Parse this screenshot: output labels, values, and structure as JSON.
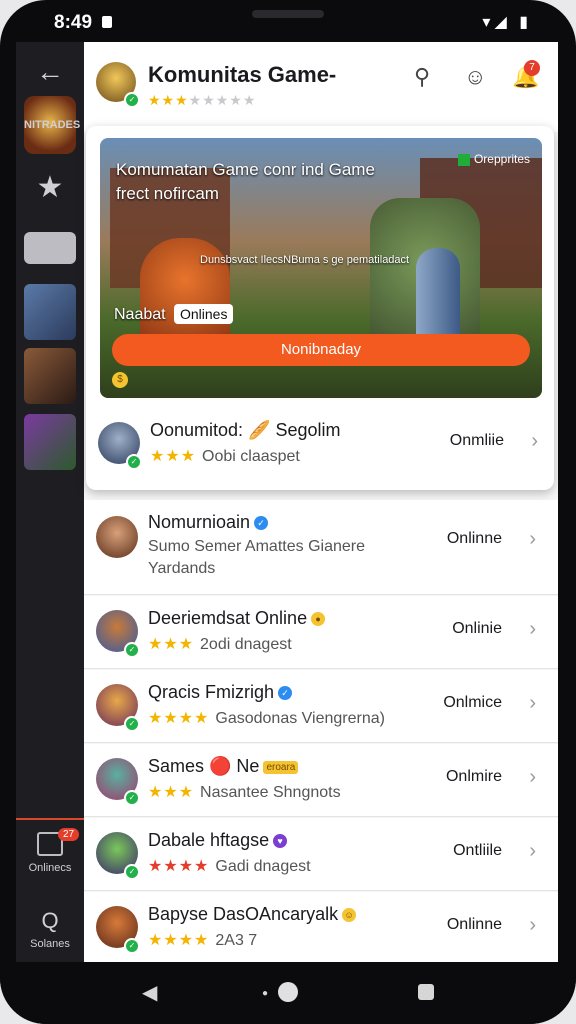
{
  "status": {
    "time": "8:49",
    "icons": "▾◢ ▮"
  },
  "rail": {
    "back": "←",
    "logo": "NITRADES",
    "star": "★",
    "onlines_label": "Onlinecs",
    "onlines_badge": "27",
    "search_label": "Solanes",
    "search_icon": "Q"
  },
  "header": {
    "title": "Komunitas Game-",
    "stars_on": "★★★",
    "stars_off": "★★★★★",
    "icons": [
      "search-icon",
      "profile-icon",
      "notification-icon"
    ],
    "notif_badge": "7"
  },
  "banner": {
    "title_line1": "Komumatan Game conr ind Game",
    "title_line2": "frect nofircam",
    "tag": "Orepprites",
    "subtitle": "Dunsbsvact IlecsNBuma s ge pematiladact",
    "label": "Naabat",
    "chip": "Onlines",
    "button": "Nonibnaday"
  },
  "rows": [
    {
      "name": "Oonumitod: 🥖 Segolim",
      "stars": "★★★",
      "sub": "Oobi claaspet",
      "status": "Onmliie",
      "badge": ""
    },
    {
      "name": "Nomurnioain",
      "stars": "",
      "sub": "Sumo Semer Amattes Gianere",
      "sub2": "Yardands",
      "status": "Onlinne",
      "badge": "v"
    },
    {
      "name": "Deeriemdsat Online",
      "stars": "★★★",
      "sub": "2odi dnagest",
      "status": "Onlinie",
      "badge": "o"
    },
    {
      "name": "Qracis Fmizrigh",
      "stars": "★★★★",
      "sub": "Gasodonas Viengrerna)",
      "status": "Onlmice",
      "badge": "v"
    },
    {
      "name": "Sames 🔴 Ne",
      "stars": "★★★",
      "sub": "Nasantee Shngnots",
      "status": "Onlmire",
      "badge": "ev",
      "ev": "eroara"
    },
    {
      "name": "Dabale hftagse",
      "stars": "★★★★",
      "sub": "Gadi dnagest",
      "status": "Ontliile",
      "badge": "vp"
    },
    {
      "name": "Bapyse DasOAncaryalk",
      "stars": "★★★★",
      "sub": "2A3 7",
      "status": "Onlinne",
      "badge": "o"
    }
  ],
  "nav": {
    "back": "◀"
  }
}
